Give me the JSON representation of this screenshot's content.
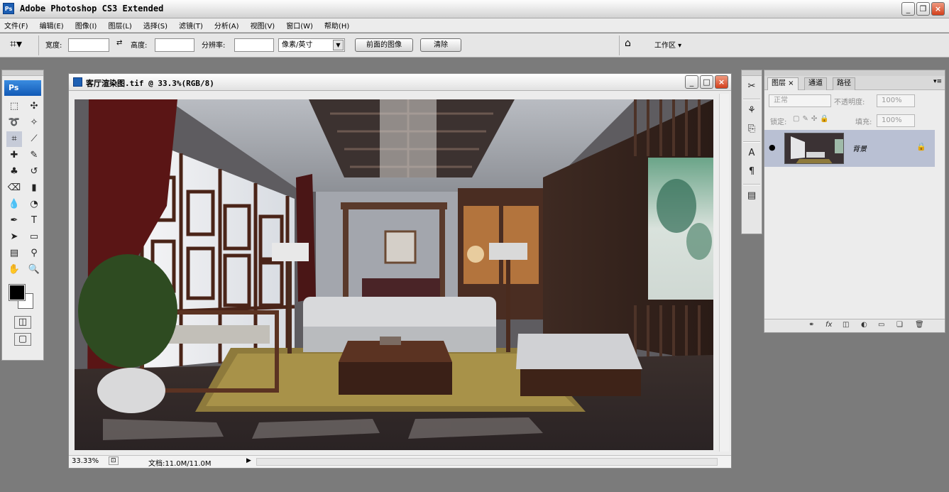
{
  "app": {
    "title": "Adobe Photoshop CS3 Extended",
    "icon_label": "Ps"
  },
  "menu": [
    "文件(F)",
    "编辑(E)",
    "图像(I)",
    "图层(L)",
    "选择(S)",
    "滤镜(T)",
    "分析(A)",
    "视图(V)",
    "窗口(W)",
    "帮助(H)"
  ],
  "options": {
    "tool_icon": "crop-icon",
    "width_label": "宽度:",
    "height_label": "高度:",
    "resolution_label": "分辨率:",
    "unit_select": "像素/英寸",
    "front_image_button": "前面的图像",
    "clear_button": "清除",
    "workspace_label": "工作区 ▾"
  },
  "toolbox": {
    "badge": "Ps"
  },
  "document": {
    "title": "客厅渲染图.tif @ 33.3%(RGB/8)",
    "zoom": "33.33%",
    "doc_info": "文档:11.0M/11.0M"
  },
  "layers_panel": {
    "tabs": [
      "图层 ×",
      "通道",
      "路径"
    ],
    "blend_mode": "正常",
    "opacity_label": "不透明度:",
    "opacity_value": "100%",
    "lock_label": "锁定:",
    "fill_label": "填充:",
    "fill_value": "100%",
    "layer_name": "背景"
  }
}
